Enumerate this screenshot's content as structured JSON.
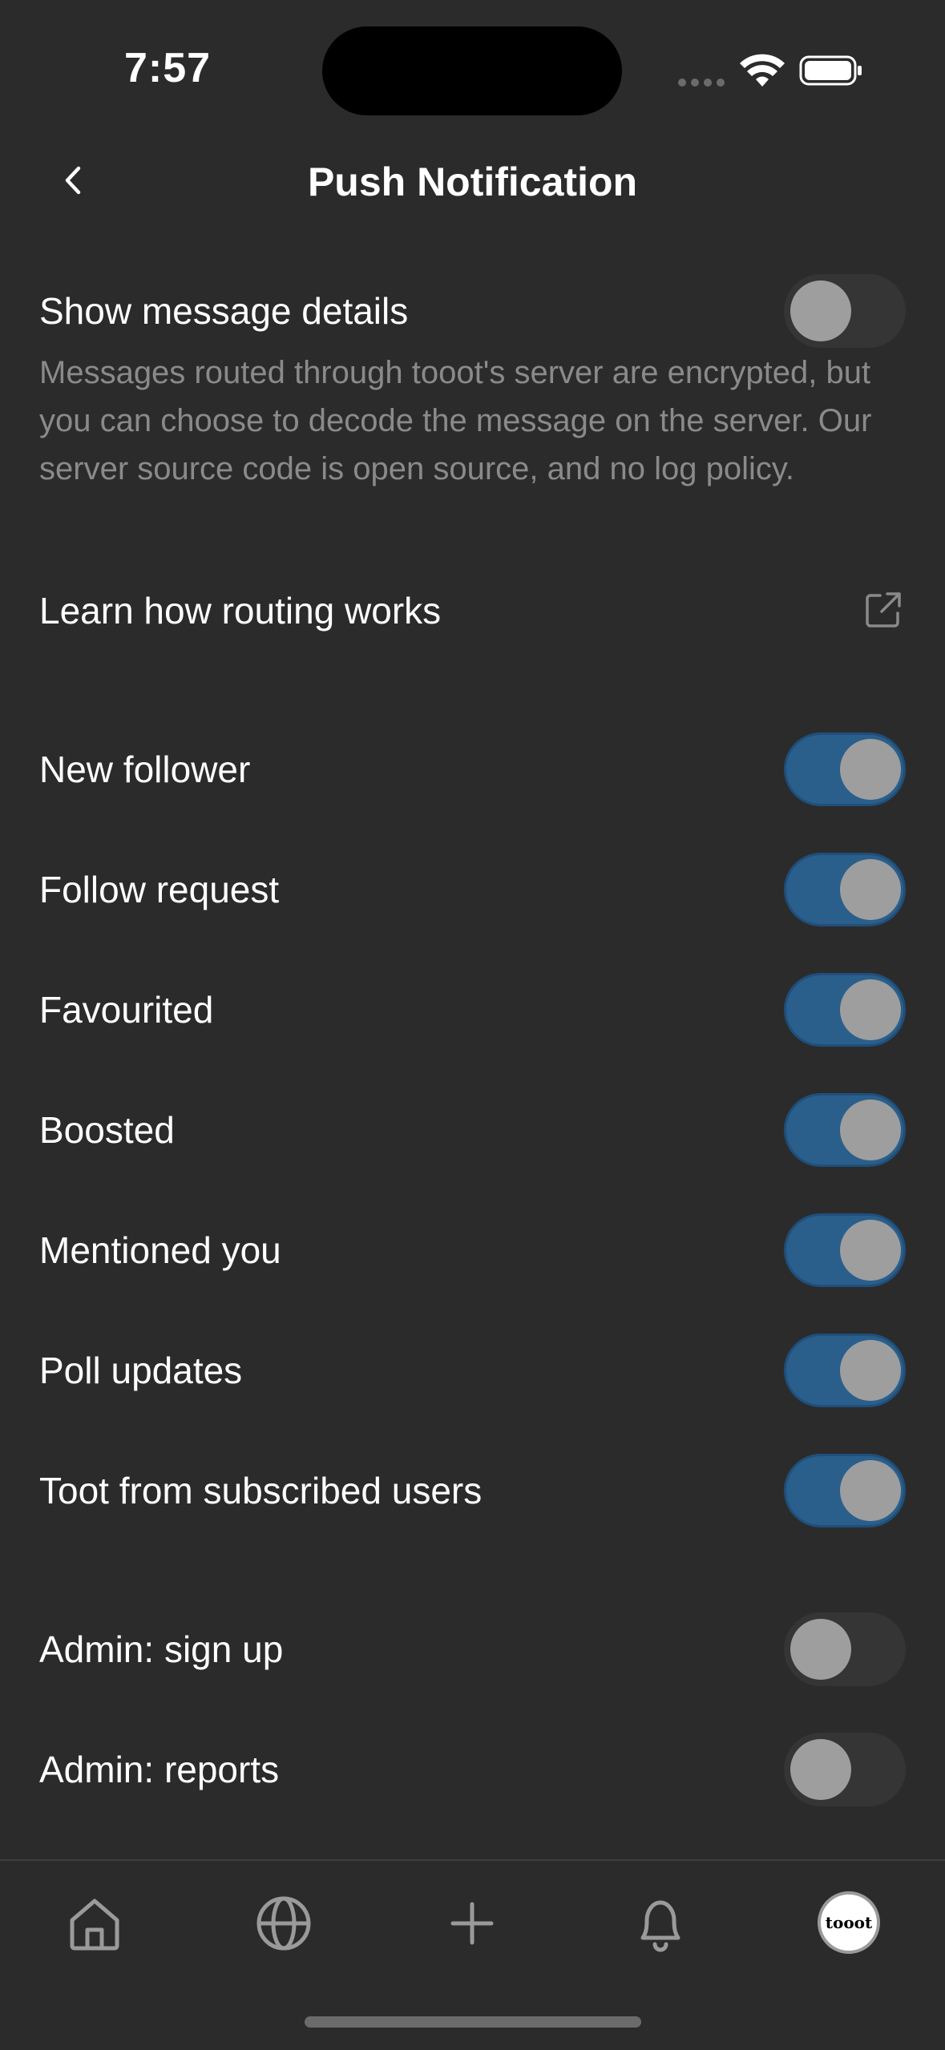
{
  "status_bar": {
    "time": "7:57"
  },
  "header": {
    "title": "Push Notification"
  },
  "message_details": {
    "label": "Show message details",
    "enabled": false,
    "description": "Messages routed through tooot's server are encrypted, but you can choose to decode the message on the server. Our server source code is open source, and no log policy."
  },
  "routing_link": {
    "label": "Learn how routing works"
  },
  "notifications": [
    {
      "label": "New follower",
      "enabled": true
    },
    {
      "label": "Follow request",
      "enabled": true
    },
    {
      "label": "Favourited",
      "enabled": true
    },
    {
      "label": "Boosted",
      "enabled": true
    },
    {
      "label": "Mentioned you",
      "enabled": true
    },
    {
      "label": "Poll updates",
      "enabled": true
    },
    {
      "label": "Toot from subscribed users",
      "enabled": true
    }
  ],
  "admin": [
    {
      "label": "Admin: sign up",
      "enabled": false
    },
    {
      "label": "Admin: reports",
      "enabled": false
    }
  ],
  "tab_bar": {
    "tabs": [
      {
        "icon": "home-icon"
      },
      {
        "icon": "globe-icon"
      },
      {
        "icon": "plus-icon"
      },
      {
        "icon": "bell-icon"
      },
      {
        "icon": "avatar"
      }
    ],
    "avatar_text": "tooot"
  },
  "colors": {
    "background": "#2b2b2c",
    "toggle_on": "#2a5f8c",
    "toggle_off": "#353535",
    "secondary_text": "#8a8a8a"
  }
}
